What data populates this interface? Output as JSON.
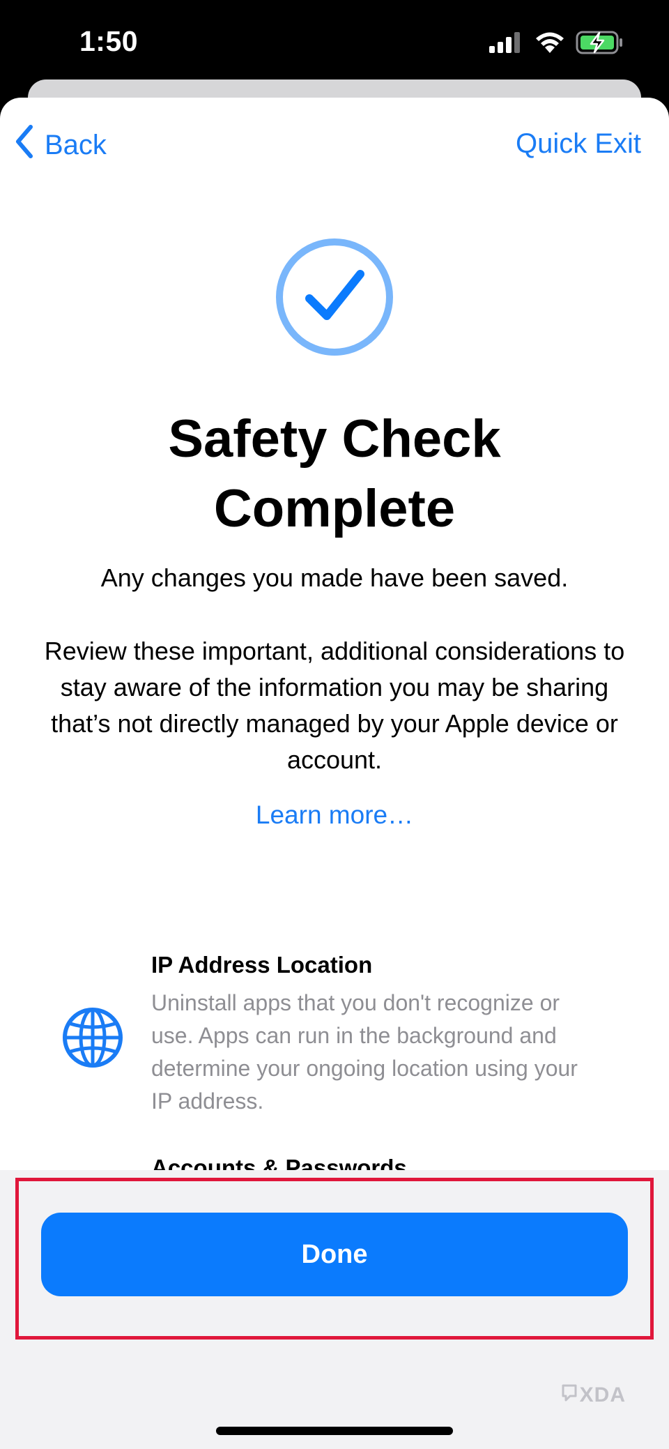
{
  "status_bar": {
    "time": "1:50",
    "icons": [
      "cellular-signal-icon",
      "wifi-icon",
      "battery-charging-icon"
    ]
  },
  "nav": {
    "back_label": "Back",
    "quick_exit_label": "Quick Exit"
  },
  "header": {
    "check_icon": "checkmark-circle-icon",
    "title": "Safety Check Complete",
    "subtitle": "Any changes you made have been saved.",
    "description": "Review these important, additional considerations to stay aware of the information you may be sharing that’s not directly managed by your Apple device or account.",
    "learn_more": "Learn more…"
  },
  "items": [
    {
      "icon": "globe-icon",
      "title": "IP Address Location",
      "description": "Uninstall apps that you don't recognize or use. Apps can run in the background and determine your ongoing location using your IP address."
    },
    {
      "title": "Accounts & Passwords"
    }
  ],
  "footer": {
    "done_label": "Done"
  },
  "watermark": {
    "text": "XDA"
  },
  "colors": {
    "accent": "#1a7cf5",
    "button": "#0b7bfd",
    "highlight_outline": "#e0173b",
    "check_ring": "#79b6fb",
    "secondary_text": "#8e8e93"
  }
}
